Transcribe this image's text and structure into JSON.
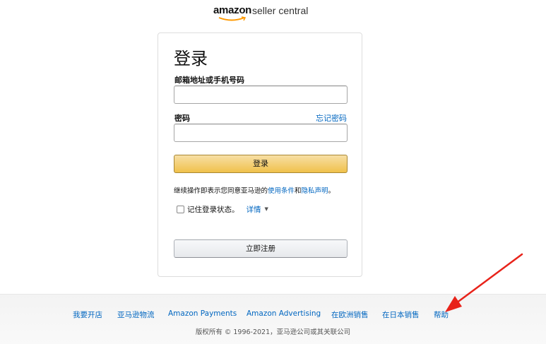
{
  "header": {
    "logo_amazon": "amazon",
    "logo_suffix": "seller central"
  },
  "login": {
    "title": "登录",
    "email_label": "邮箱地址或手机号码",
    "email_value": "",
    "password_label": "密码",
    "password_value": "",
    "forgot_password": "忘记密码",
    "signin_button": "登录",
    "terms_prefix": "继续操作即表示您同意亚马逊的",
    "terms_link_conditions": "使用条件",
    "terms_and": "和",
    "terms_link_privacy": "隐私声明",
    "terms_suffix": "。",
    "remember_label": "记住登录状态。",
    "details_link": "详情",
    "register_button": "立即注册"
  },
  "footer": {
    "links": [
      "我要开店",
      "亚马逊物流",
      "Amazon Payments",
      "Amazon Advertising",
      "在欧洲销售",
      "在日本销售",
      "帮助"
    ],
    "copyright": "版权所有 © 1996-2021，亚马逊公司或其关联公司"
  },
  "colors": {
    "link": "#0066c0",
    "signin_button": "#f0c14b",
    "annotation_arrow": "#e8231a"
  },
  "icons": {
    "caret": "caret-down-icon",
    "checkbox": "checkbox-icon",
    "logo_smile": "amazon-smile-icon"
  }
}
